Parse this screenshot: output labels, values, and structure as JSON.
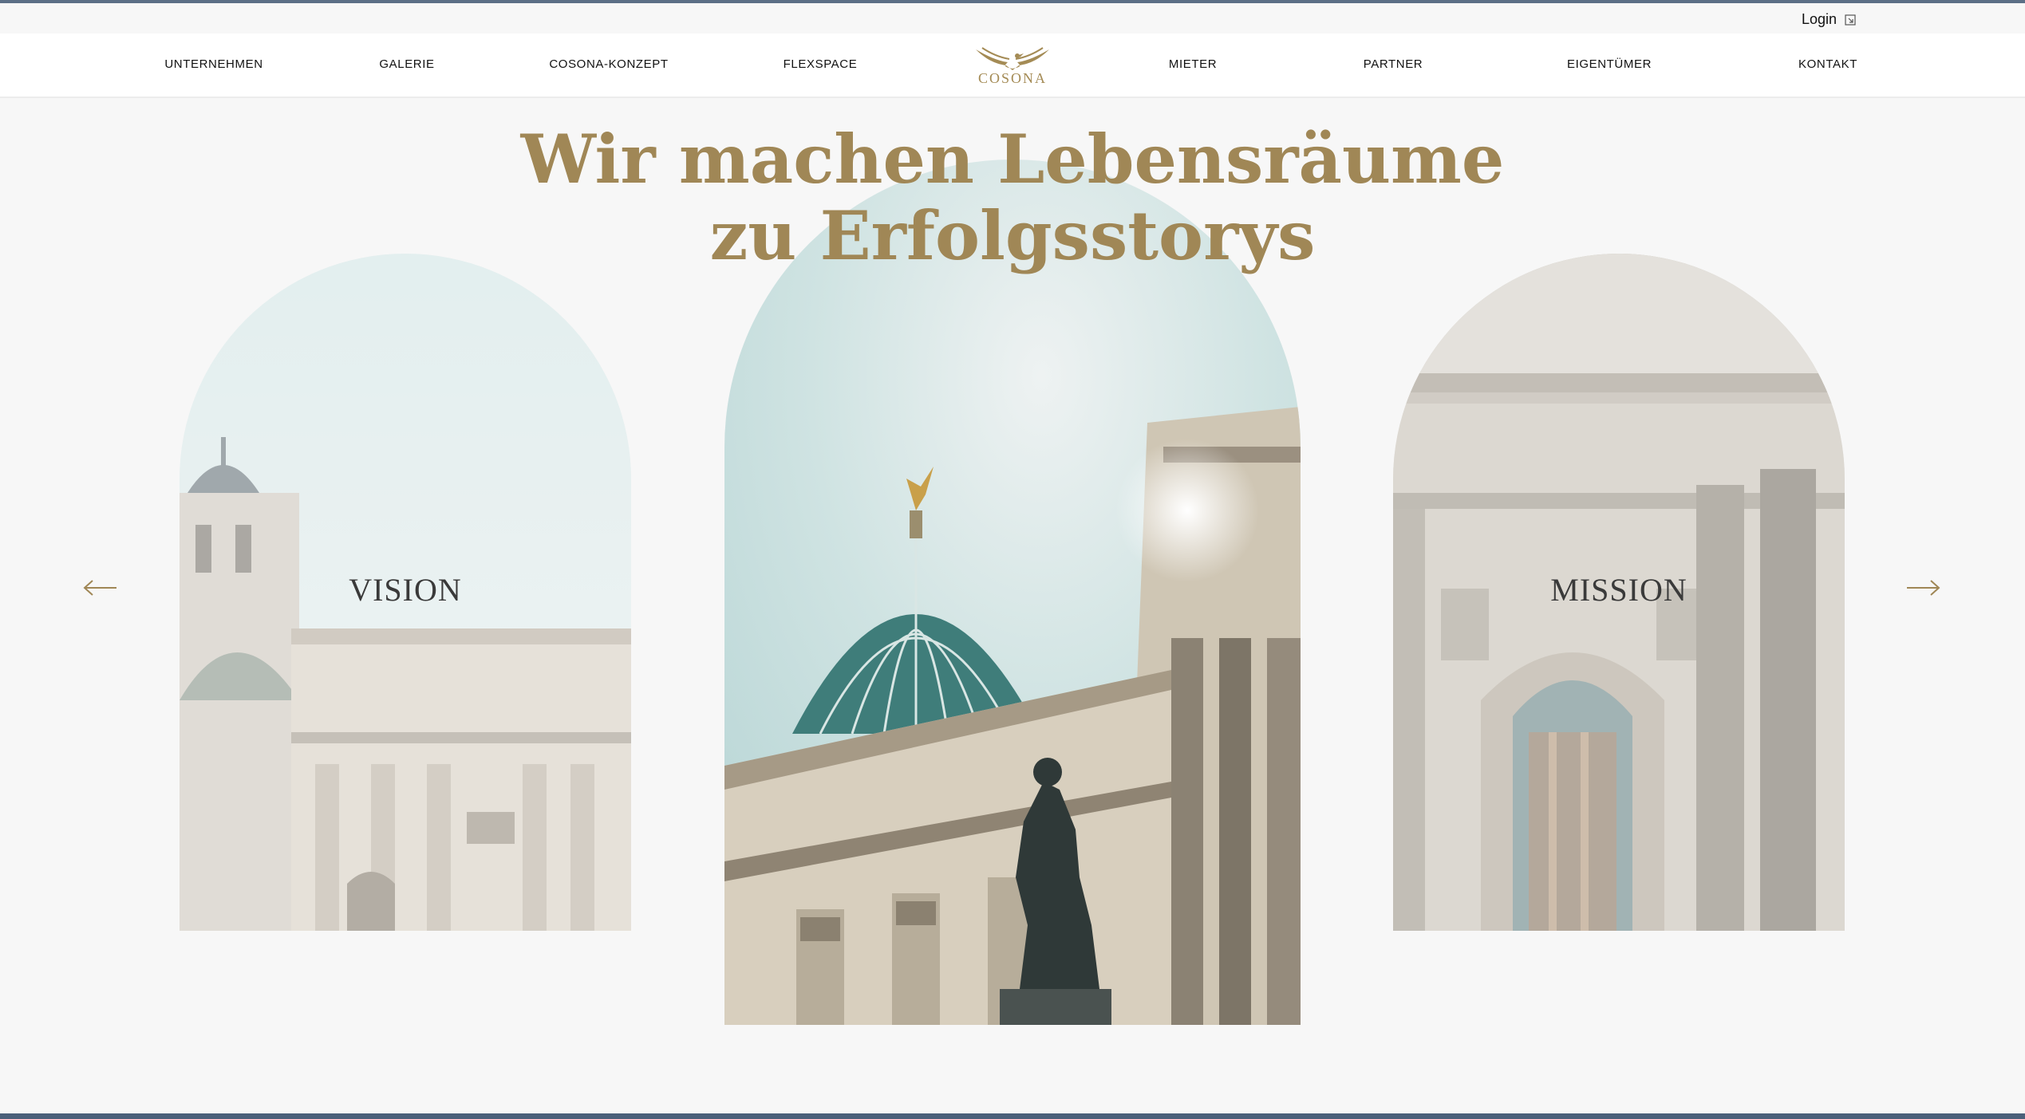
{
  "topbar": {
    "login_label": "Login",
    "login_icon": "external-link-icon"
  },
  "nav": {
    "items": [
      "UNTERNEHMEN",
      "GALERIE",
      "COSONA-KONZEPT",
      "FLEXSPACE",
      "MIETER",
      "PARTNER",
      "EIGENTÜMER",
      "KONTAKT"
    ],
    "logo_text": "COSONA"
  },
  "hero": {
    "headline_line1": "Wir machen Lebensräume",
    "headline_line2": "zu Erfolgsstorys",
    "slides": [
      {
        "label": "VISION"
      },
      {
        "label": ""
      },
      {
        "label": "MISSION"
      }
    ],
    "prev_icon": "arrow-left-icon",
    "next_icon": "arrow-right-icon"
  },
  "colors": {
    "accent": "#a08756",
    "nav_bg": "#ffffff",
    "page_bg": "#f7f7f7",
    "frame": "#4b607a"
  }
}
